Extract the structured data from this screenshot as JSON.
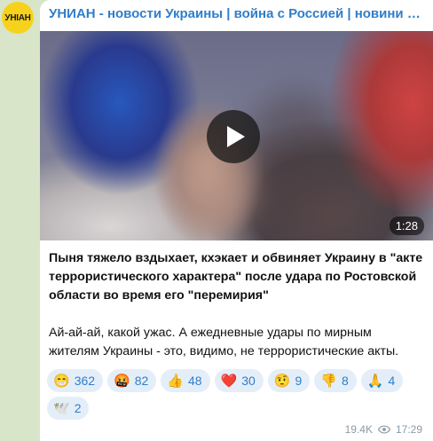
{
  "channel": {
    "name": "УНИАН - новости Украины | война с Россией | новини Украіни | війна з Росією",
    "avatar_text": "УНІАН",
    "avatar_color": "#f7d21c"
  },
  "video": {
    "duration": "1:28"
  },
  "post": {
    "headline": "Пыня тяжело вздыхает, кхэкает и обвиняет Украину в \"акте террористического характера\" после удара по Ростовской области во время его \"перемирия\"",
    "body": "Ай-ай-ай, какой ужас. А ежедневные удары по мирным жителям Украины - это, видимо, не террористические акты."
  },
  "reactions": [
    {
      "emoji": "😁",
      "count": "362"
    },
    {
      "emoji": "🤬",
      "count": "82"
    },
    {
      "emoji": "👍",
      "count": "48"
    },
    {
      "emoji": "❤️",
      "count": "30"
    },
    {
      "emoji": "🤨",
      "count": "9"
    },
    {
      "emoji": "👎",
      "count": "8"
    },
    {
      "emoji": "🙏",
      "count": "4"
    },
    {
      "emoji": "🕊️",
      "count": "2"
    }
  ],
  "meta": {
    "views": "19.4K",
    "time": "17:29"
  },
  "colors": {
    "link": "#2f7ec9",
    "background": "#d9e5c9",
    "reaction_bg": "#e4eef9"
  }
}
